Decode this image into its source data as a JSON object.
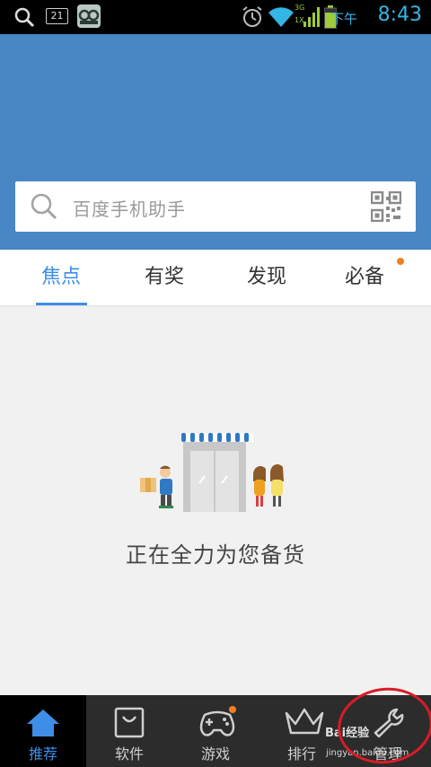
{
  "status_bar": {
    "date_badge": "21",
    "network": "3G",
    "network_sub": "1X",
    "ampm": "下午",
    "time": "8:43"
  },
  "search": {
    "placeholder": "百度手机助手"
  },
  "tabs": [
    {
      "label": "焦点",
      "active": true
    },
    {
      "label": "有奖",
      "active": false
    },
    {
      "label": "发现",
      "active": false
    },
    {
      "label": "必备",
      "active": false,
      "badge": true
    }
  ],
  "empty_state": {
    "message": "正在全力为您备货"
  },
  "bottom_nav": [
    {
      "label": "推荐",
      "icon": "home-icon",
      "active": true
    },
    {
      "label": "软件",
      "icon": "shopping-bag-icon",
      "active": false
    },
    {
      "label": "游戏",
      "icon": "gamepad-icon",
      "active": false,
      "badge": true
    },
    {
      "label": "排行",
      "icon": "crown-icon",
      "active": false
    },
    {
      "label": "管理",
      "icon": "wrench-icon",
      "active": false
    }
  ],
  "watermark": {
    "brand": "Bai经验",
    "url": "jingyan.baidu.com"
  },
  "colors": {
    "header_blue": "#4886c4",
    "accent_blue": "#3e8ee8",
    "badge_orange": "#f07f1f",
    "nav_bg": "#2c2c2c",
    "annotation_red": "#d91c28"
  }
}
